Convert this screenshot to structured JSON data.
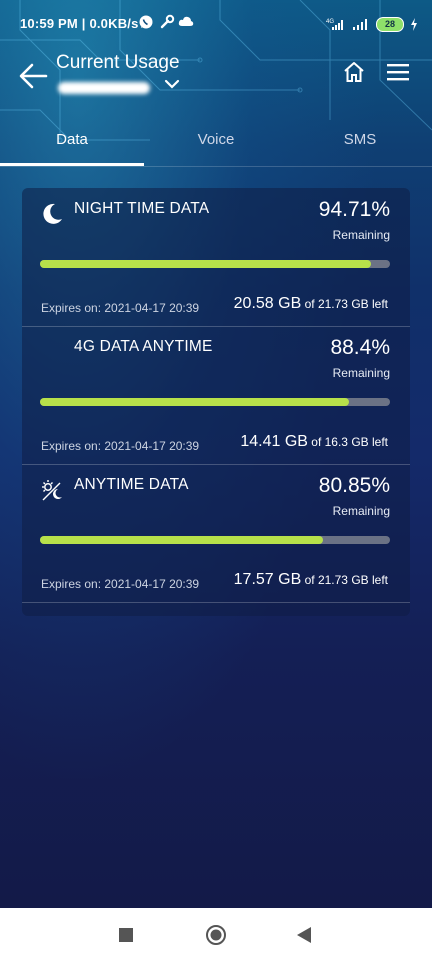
{
  "status_bar": {
    "time": "10:59 PM",
    "speed": "0.0KB/s",
    "network_label": "4G",
    "battery": "28"
  },
  "header": {
    "title": "Current Usage"
  },
  "tabs": [
    {
      "label": "Data",
      "active": true
    },
    {
      "label": "Voice",
      "active": false
    },
    {
      "label": "SMS",
      "active": false
    }
  ],
  "plans": [
    {
      "name": "NIGHT TIME DATA",
      "icon": "moon-icon",
      "percent": "94.71%",
      "remaining_label": "Remaining",
      "progress": 0.9471,
      "expires": "Expires on: 2021-04-17 20:39",
      "used": "20.58 GB",
      "total": "of 21.73 GB left"
    },
    {
      "name": "4G DATA ANYTIME",
      "icon": "",
      "percent": "88.4%",
      "remaining_label": "Remaining",
      "progress": 0.884,
      "expires": "Expires on: 2021-04-17 20:39",
      "used": "14.41 GB",
      "total": "of 16.3 GB left"
    },
    {
      "name": "ANYTIME DATA",
      "icon": "day-night-icon",
      "percent": "80.85%",
      "remaining_label": "Remaining",
      "progress": 0.8085,
      "expires": "Expires on: 2021-04-17 20:39",
      "used": "17.57 GB",
      "total": "of 21.73 GB left"
    }
  ],
  "colors": {
    "progress_fill": "#b7e14a",
    "progress_track": "#6b7285"
  }
}
